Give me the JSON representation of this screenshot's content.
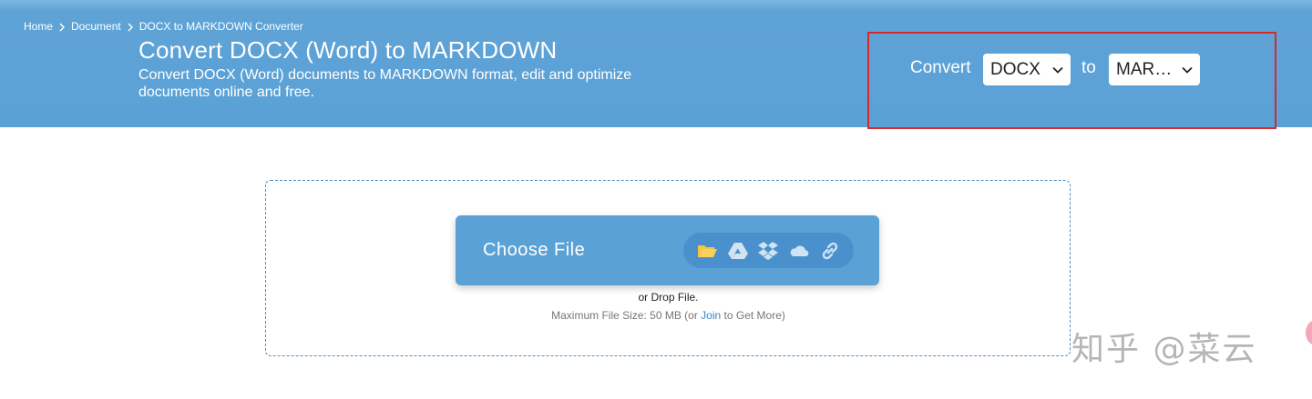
{
  "breadcrumb": {
    "items": [
      "Home",
      "Document",
      "DOCX to MARKDOWN Converter"
    ]
  },
  "header": {
    "title": "Convert DOCX (Word) to MARKDOWN",
    "subtitle": "Convert DOCX (Word) documents to MARKDOWN format, edit and optimize documents online and free."
  },
  "converter": {
    "convert_label": "Convert",
    "from_value": "DOCX",
    "to_label": "to",
    "to_value": "MAR…"
  },
  "upload": {
    "choose_label": "Choose File",
    "sources": [
      "folder-icon",
      "google-drive-icon",
      "dropbox-icon",
      "onedrive-icon",
      "url-link-icon"
    ],
    "drop_text": "or Drop File.",
    "max_prefix": "Maximum File Size: 50 MB (or ",
    "join_label": "Join",
    "max_suffix": " to Get More)"
  },
  "watermark": "知乎 @菜云",
  "colors": {
    "header_blue": "#5aa1d6",
    "highlight_red": "#d9282a",
    "folder_yellow": "#f4c542",
    "icon_light": "#cfe3f3",
    "link_blue": "#3a86c8"
  }
}
